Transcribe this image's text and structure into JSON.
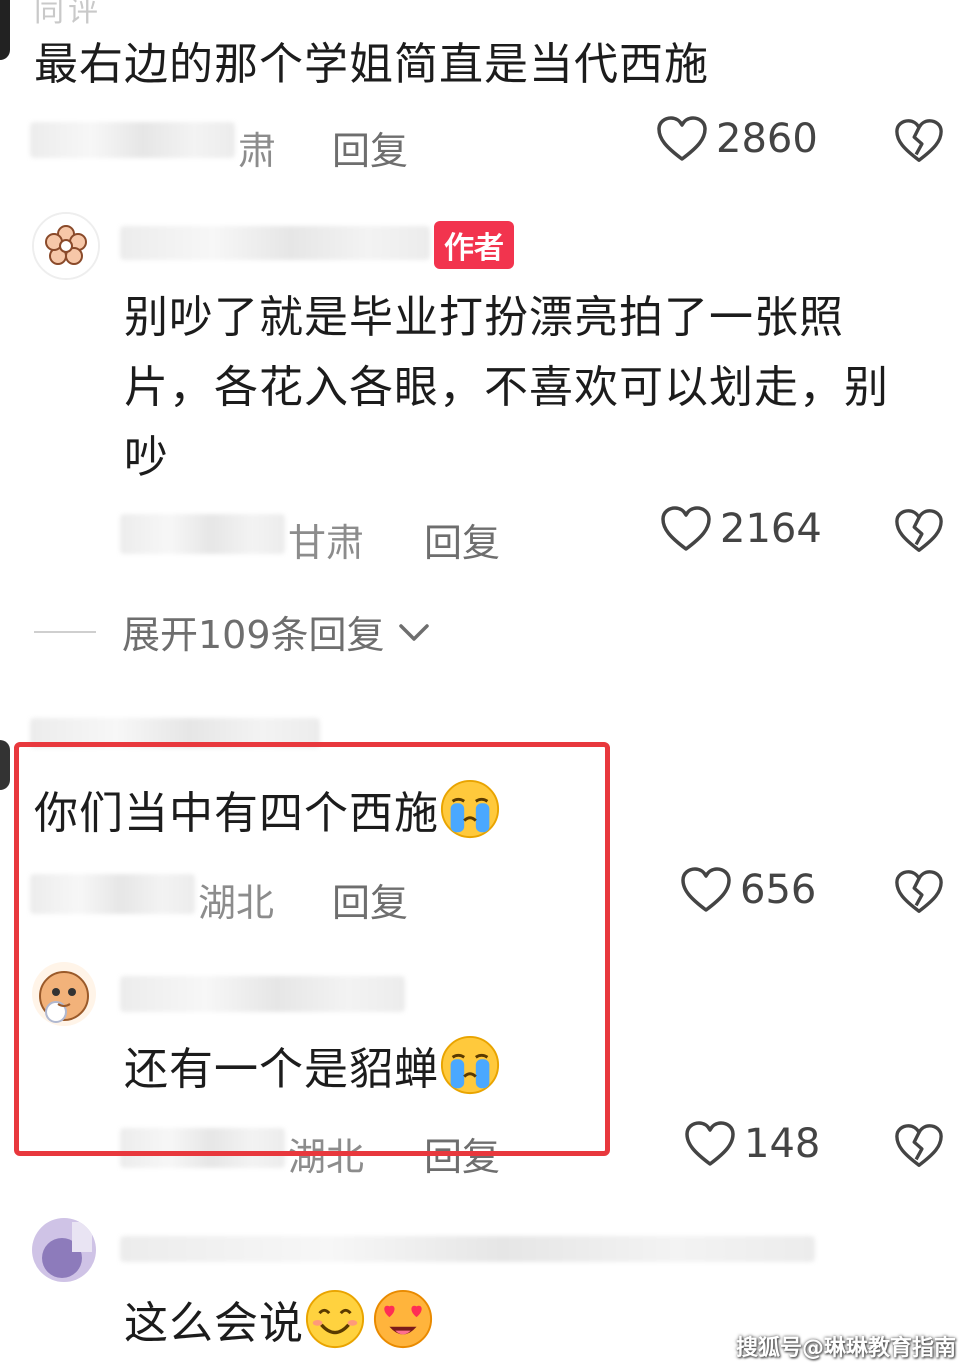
{
  "faded_header": "同评",
  "comments": [
    {
      "text": "最右边的那个学姐简直是当代西施",
      "location": "肃",
      "reply_label": "回复",
      "likes": "2860"
    },
    {
      "author_badge": "作者",
      "text_lines": [
        "别吵了就是毕业打扮漂亮拍了一张照",
        "片，各花入各眼，不喜欢可以划走，别",
        "吵"
      ],
      "location": "甘肃",
      "reply_label": "回复",
      "likes": "2164",
      "expand_label": "展开109条回复"
    },
    {
      "text": "你们当中有四个西施",
      "location": "湖北",
      "reply_label": "回复",
      "likes": "656"
    },
    {
      "text": "还有一个是貂蝉",
      "location": "湖北",
      "reply_label": "回复",
      "likes": "148"
    },
    {
      "text": "这么会说"
    }
  ],
  "watermark": "搜狐号@琳琳教育指南",
  "colors": {
    "highlight_border": "#e8383d",
    "author_badge": "#f2344e"
  },
  "icons": [
    "heart-outline-icon",
    "broken-heart-icon",
    "chevron-down-icon",
    "crying-emoji",
    "smile-emoji",
    "heart-eyes-emoji"
  ]
}
